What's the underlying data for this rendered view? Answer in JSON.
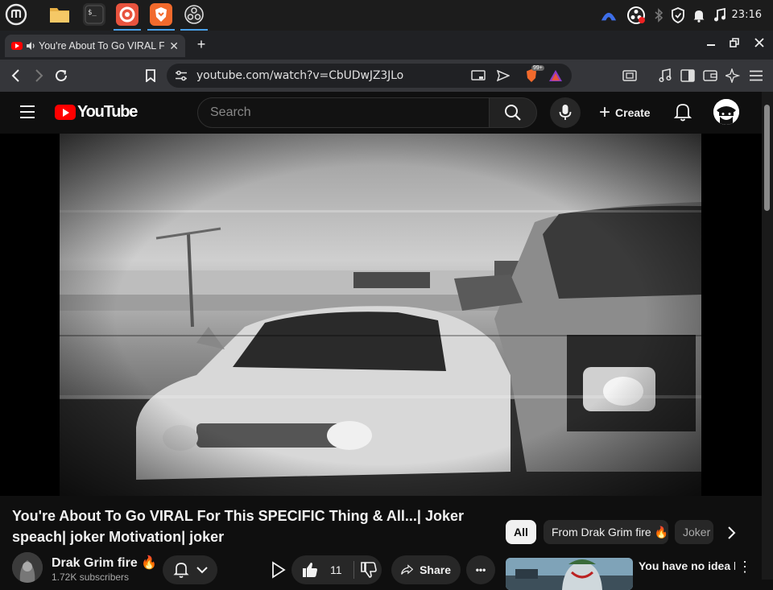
{
  "panel": {
    "apps": [
      {
        "name": "mint-menu-icon"
      },
      {
        "name": "folder-icon"
      },
      {
        "name": "terminal-icon"
      },
      {
        "name": "firefox-icon"
      },
      {
        "name": "brave-icon"
      },
      {
        "name": "obs-icon"
      }
    ],
    "tray": [
      "vpn-icon",
      "obs-tray-icon",
      "bluetooth-icon",
      "shield-icon",
      "notification-icon",
      "music-icon"
    ],
    "clock": "23:16"
  },
  "browser": {
    "tab_title": "You're About To Go VIRAL For This SPECIFIC Thing & All...| Joker speach| joker Motivation| joker",
    "tab_close": "✕",
    "new_tab": "+",
    "url": "youtube.com/watch?v=CbUDwJZ3JLo",
    "brave_badge": "99+"
  },
  "youtube": {
    "wordmark": "YouTube",
    "search_placeholder": "Search",
    "create_label": "Create",
    "video": {
      "title": "You're About To Go VIRAL For This SPECIFIC Thing & All...| Joker speach| joker Motivation| joker",
      "channel": "Drak Grim fire 🔥",
      "subscribers": "1.72K subscribers",
      "likes": "11",
      "share_label": "Share",
      "more": "•••"
    },
    "chips": [
      "All",
      "From Drak Grim fire 🔥",
      "Joker"
    ],
    "suggestion": {
      "title": "You have no idea how powerful you",
      "more": "⋮"
    }
  }
}
